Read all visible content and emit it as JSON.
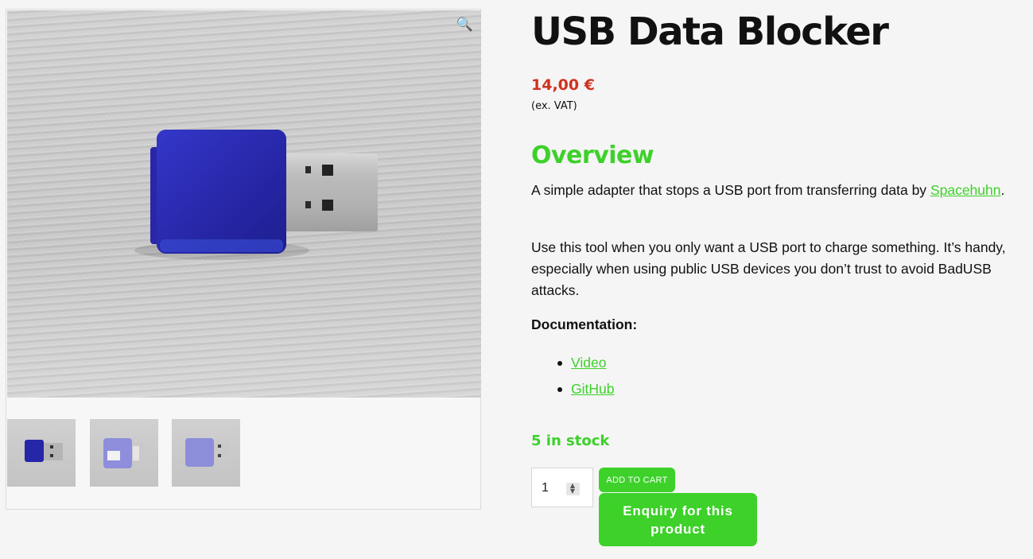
{
  "product": {
    "title": "USB Data Blocker",
    "price": "14,00 €",
    "vat_note": "(ex. VAT)"
  },
  "gallery": {
    "zoom_icon": "magnifier-icon",
    "thumbnails": [
      {
        "alt": "blue-usb-blocker-thumbnail"
      },
      {
        "alt": "light-usb-blocker-thumbnail"
      },
      {
        "alt": "light-usb-blocker-angle-thumbnail"
      }
    ]
  },
  "overview": {
    "heading": "Overview",
    "para1_text": "A simple adapter that stops a USB port from transferring data by",
    "para1_link": "Spacehuhn",
    "para1_end": ".",
    "para2": "Use this tool when you only want a USB port to charge something. It’s handy, especially when using public USB devices you don’t trust to avoid BadUSB attacks.",
    "doc_label": "Documentation:",
    "doc_links": [
      "Video",
      "GitHub"
    ]
  },
  "purchase": {
    "stock": "5 in stock",
    "quantity": "1",
    "add_to_cart": "ADD TO CART",
    "enquiry": "Enquiry for this product"
  },
  "colors": {
    "accent": "#3dd12a",
    "price": "#d0311f"
  }
}
